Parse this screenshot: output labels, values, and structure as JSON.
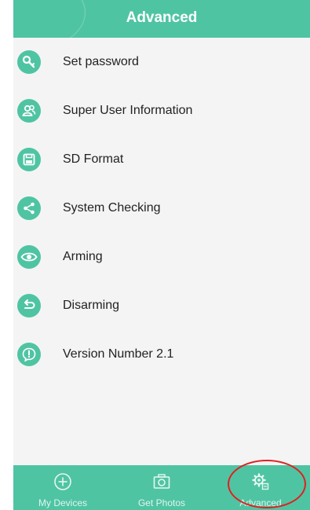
{
  "header": {
    "title": "Advanced"
  },
  "menu": {
    "items": [
      {
        "label": "Set password",
        "icon": "key-icon"
      },
      {
        "label": "Super User Information",
        "icon": "users-icon"
      },
      {
        "label": "SD Format",
        "icon": "floppy-disk-icon"
      },
      {
        "label": "System Checking",
        "icon": "share-icon"
      },
      {
        "label": "Arming",
        "icon": "eye-icon"
      },
      {
        "label": "Disarming",
        "icon": "undo-icon"
      },
      {
        "label": "Version Number 2.1",
        "icon": "exclamation-icon"
      }
    ]
  },
  "tabbar": {
    "tabs": [
      {
        "label": "My Devices",
        "icon": "plus-circle-icon"
      },
      {
        "label": "Get Photos",
        "icon": "camera-icon"
      },
      {
        "label": "Advanced",
        "icon": "gear-icon",
        "selected": true
      }
    ]
  },
  "colors": {
    "accent": "#4fc4a3",
    "background": "#f4f4f4",
    "highlight_ring": "#e02020"
  }
}
